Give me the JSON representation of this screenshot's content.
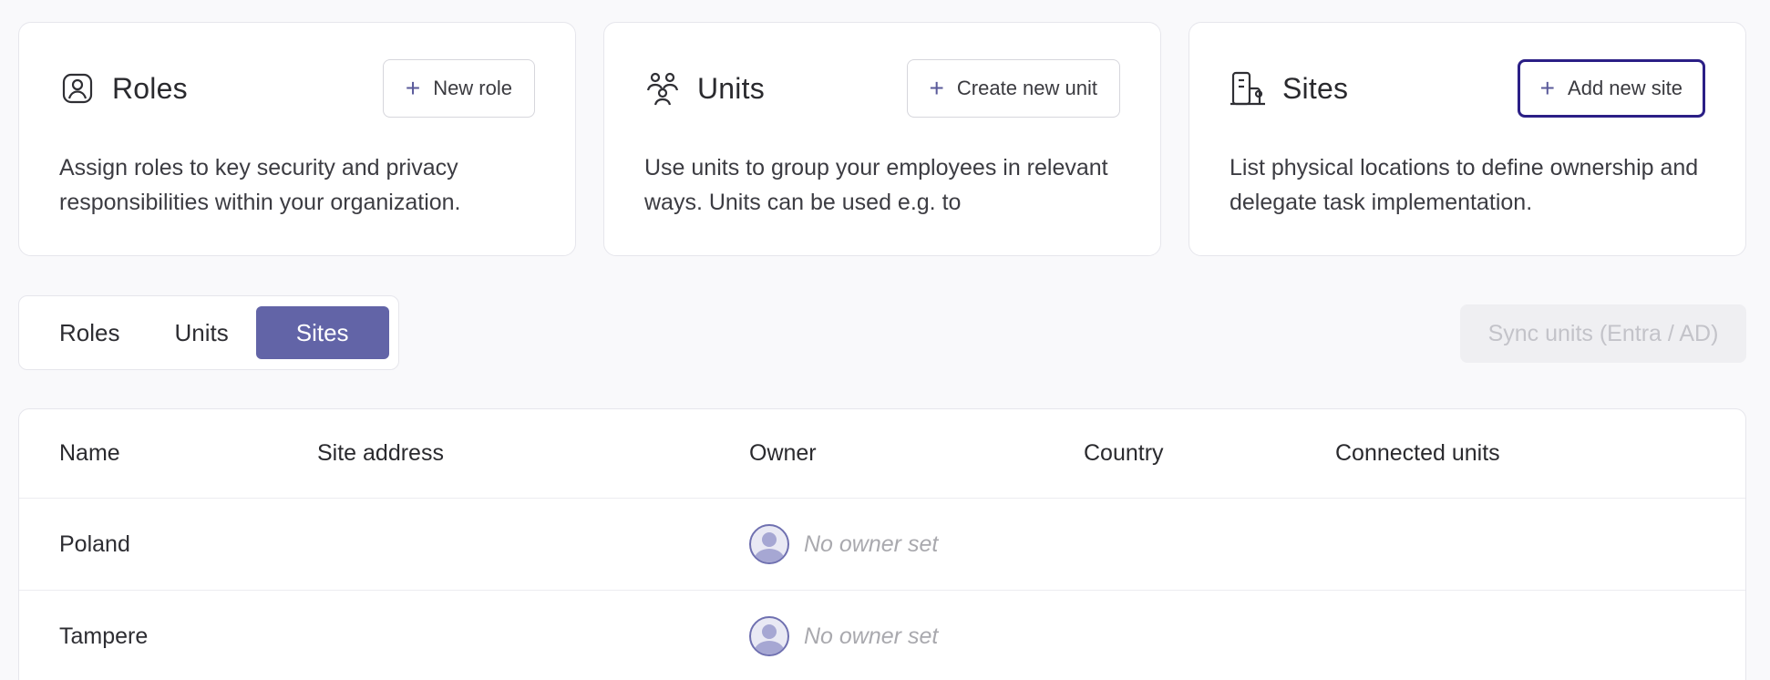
{
  "cards": [
    {
      "title": "Roles",
      "icon": "user-badge-icon",
      "button_label": "New role",
      "description": "Assign roles to key security and privacy responsibilities within your organization."
    },
    {
      "title": "Units",
      "icon": "people-group-icon",
      "button_label": "Create new unit",
      "description": "Use units to group your employees in relevant ways. Units can be used e.g. to"
    },
    {
      "title": "Sites",
      "icon": "building-icon",
      "button_label": "Add new site",
      "description": "List physical locations to define ownership and delegate task implementation."
    }
  ],
  "tabs": {
    "items": [
      "Roles",
      "Units",
      "Sites"
    ],
    "active": "Sites"
  },
  "sync_button_label": "Sync units (Entra / AD)",
  "table": {
    "columns": [
      "Name",
      "Site address",
      "Owner",
      "Country",
      "Connected units"
    ],
    "rows": [
      {
        "name": "Poland",
        "site_address": "",
        "owner": "No owner set",
        "country": "",
        "connected_units": ""
      },
      {
        "name": "Tampere",
        "site_address": "",
        "owner": "No owner set",
        "country": "",
        "connected_units": ""
      }
    ]
  },
  "colors": {
    "accent": "#6264a7",
    "focus_ring": "#2b1f86",
    "muted_text": "#a9a9ae",
    "disabled_bg": "#efeff2"
  }
}
